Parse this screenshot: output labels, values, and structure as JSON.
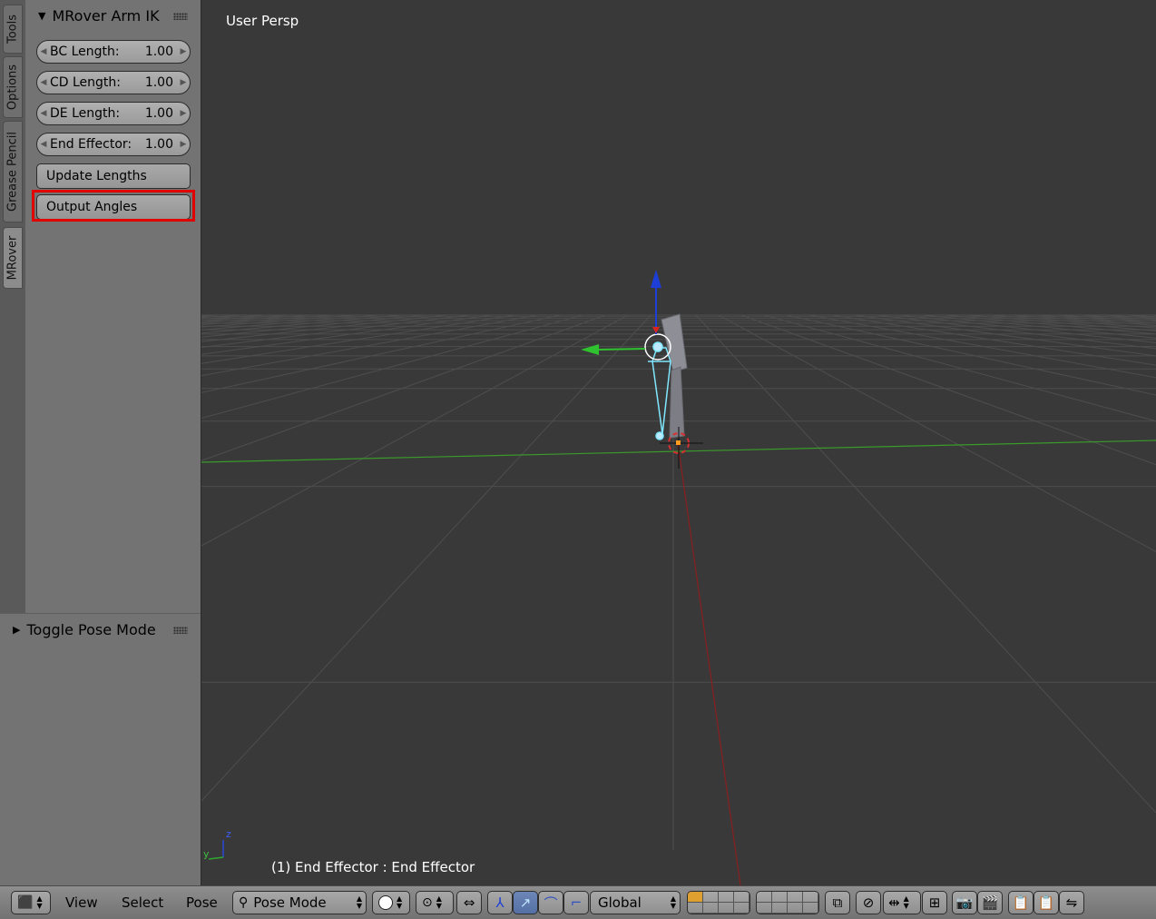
{
  "shelf": {
    "tabs": [
      "Tools",
      "Options",
      "Grease Pencil",
      "MRover"
    ],
    "active_tab": "MRover",
    "panel_title": "MRover Arm IK",
    "fields": [
      {
        "label": "BC Length:",
        "value": "1.00"
      },
      {
        "label": "CD Length:",
        "value": "1.00"
      },
      {
        "label": "DE Length:",
        "value": "1.00"
      },
      {
        "label": "End Effector:",
        "value": "1.00"
      }
    ],
    "update_button": "Update Lengths",
    "output_button": "Output Angles",
    "lower_panel_title": "Toggle Pose Mode"
  },
  "viewport": {
    "view_label": "User Persp",
    "object_info": "(1) End Effector : End Effector",
    "axis_z": "z",
    "axis_y": "y"
  },
  "header": {
    "menu_view": "View",
    "menu_select": "Select",
    "menu_pose": "Pose",
    "mode": "Pose Mode",
    "orientation": "Global"
  },
  "colors": {
    "highlight": "#e00000",
    "x_axis": "#8a1f1f",
    "y_axis": "#3a9a2a",
    "z_axis": "#1d3fd8",
    "bone_selected": "#7fe8ff"
  }
}
